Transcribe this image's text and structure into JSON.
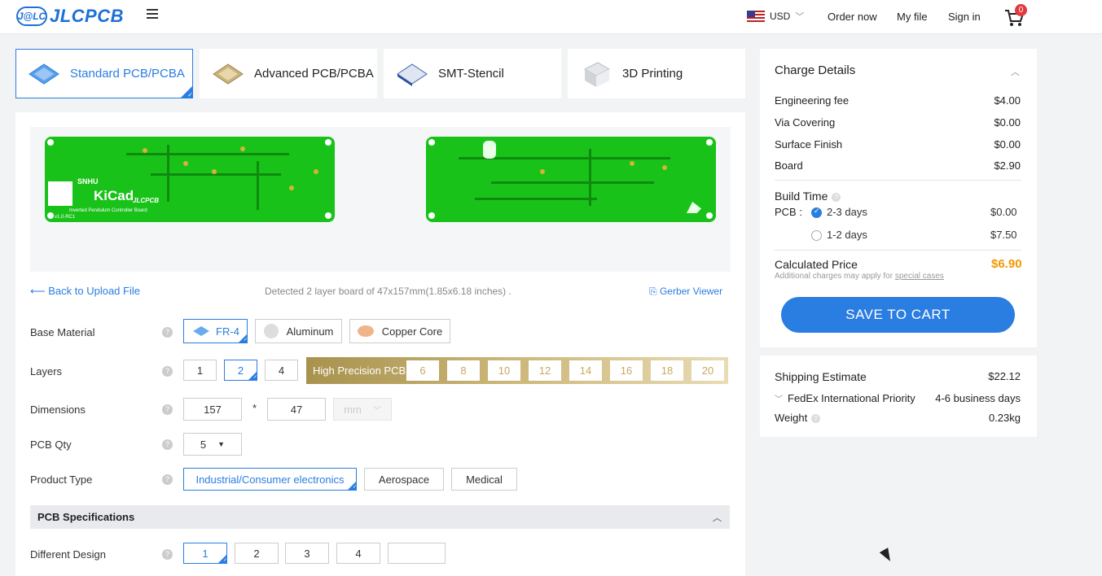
{
  "header": {
    "logo_mark": "J@LC",
    "logo_text": "JLCPCB",
    "currency": "USD",
    "nav": [
      "Order now",
      "My file",
      "Sign in"
    ],
    "cart_count": "0"
  },
  "tabs": [
    {
      "label": "Standard PCB/PCBA",
      "icon": "pcb-blue-icon",
      "active": true
    },
    {
      "label": "Advanced PCB/PCBA",
      "icon": "pcb-gold-icon",
      "active": false
    },
    {
      "label": "SMT-Stencil",
      "icon": "stencil-icon",
      "active": false
    },
    {
      "label": "3D Printing",
      "icon": "3d-printing-icon",
      "active": false
    }
  ],
  "upload": {
    "back_link": "Back to Upload File",
    "detected": "Detected 2 layer board of 47x157mm(1.85x6.18 inches) .",
    "gerber_viewer": "Gerber Viewer",
    "board_front_text": [
      "SNHU",
      "KiCad",
      "JLCPCB",
      "Inverted Pendulum Controller Board",
      "v1.0-RC1"
    ]
  },
  "form": {
    "base_material": {
      "label": "Base Material",
      "options": [
        "FR-4",
        "Aluminum",
        "Copper Core"
      ],
      "selected": "FR-4"
    },
    "layers": {
      "label": "Layers",
      "options": [
        "1",
        "2",
        "4"
      ],
      "selected": "2",
      "high_precision_label": "High Precision PCB",
      "high_precision_options": [
        "6",
        "8",
        "10",
        "12",
        "14",
        "16",
        "18",
        "20"
      ]
    },
    "dimensions": {
      "label": "Dimensions",
      "width": "157",
      "sep": "*",
      "height": "47",
      "unit": "mm"
    },
    "pcb_qty": {
      "label": "PCB Qty",
      "value": "5"
    },
    "product_type": {
      "label": "Product Type",
      "options": [
        "Industrial/Consumer electronics",
        "Aerospace",
        "Medical"
      ],
      "selected": "Industrial/Consumer electronics"
    },
    "pcb_specifications": "PCB Specifications",
    "different_design": {
      "label": "Different Design",
      "options": [
        "1",
        "2",
        "3",
        "4",
        ""
      ],
      "selected": "1"
    }
  },
  "charge": {
    "title": "Charge Details",
    "rows": [
      {
        "label": "Engineering fee",
        "value": "$4.00"
      },
      {
        "label": "Via Covering",
        "value": "$0.00"
      },
      {
        "label": "Surface Finish",
        "value": "$0.00"
      },
      {
        "label": "Board",
        "value": "$2.90"
      }
    ],
    "build_time": "Build Time",
    "pcb_label": "PCB :",
    "build_options": [
      {
        "label": "2-3 days",
        "value": "$0.00",
        "selected": true
      },
      {
        "label": "1-2 days",
        "value": "$7.50",
        "selected": false
      }
    ],
    "calculated_price_label": "Calculated Price",
    "calculated_price": "$6.90",
    "note": "Additional charges may apply for",
    "note_link": "special cases",
    "save_button": "SAVE TO CART"
  },
  "shipping": {
    "title": "Shipping Estimate",
    "price": "$22.12",
    "method": "FedEx International Priority",
    "eta": "4-6 business days",
    "weight_label": "Weight",
    "weight": "0.23kg"
  },
  "colors": {
    "accent": "#2a7de1",
    "price": "#f39800",
    "board": "#19c219"
  }
}
